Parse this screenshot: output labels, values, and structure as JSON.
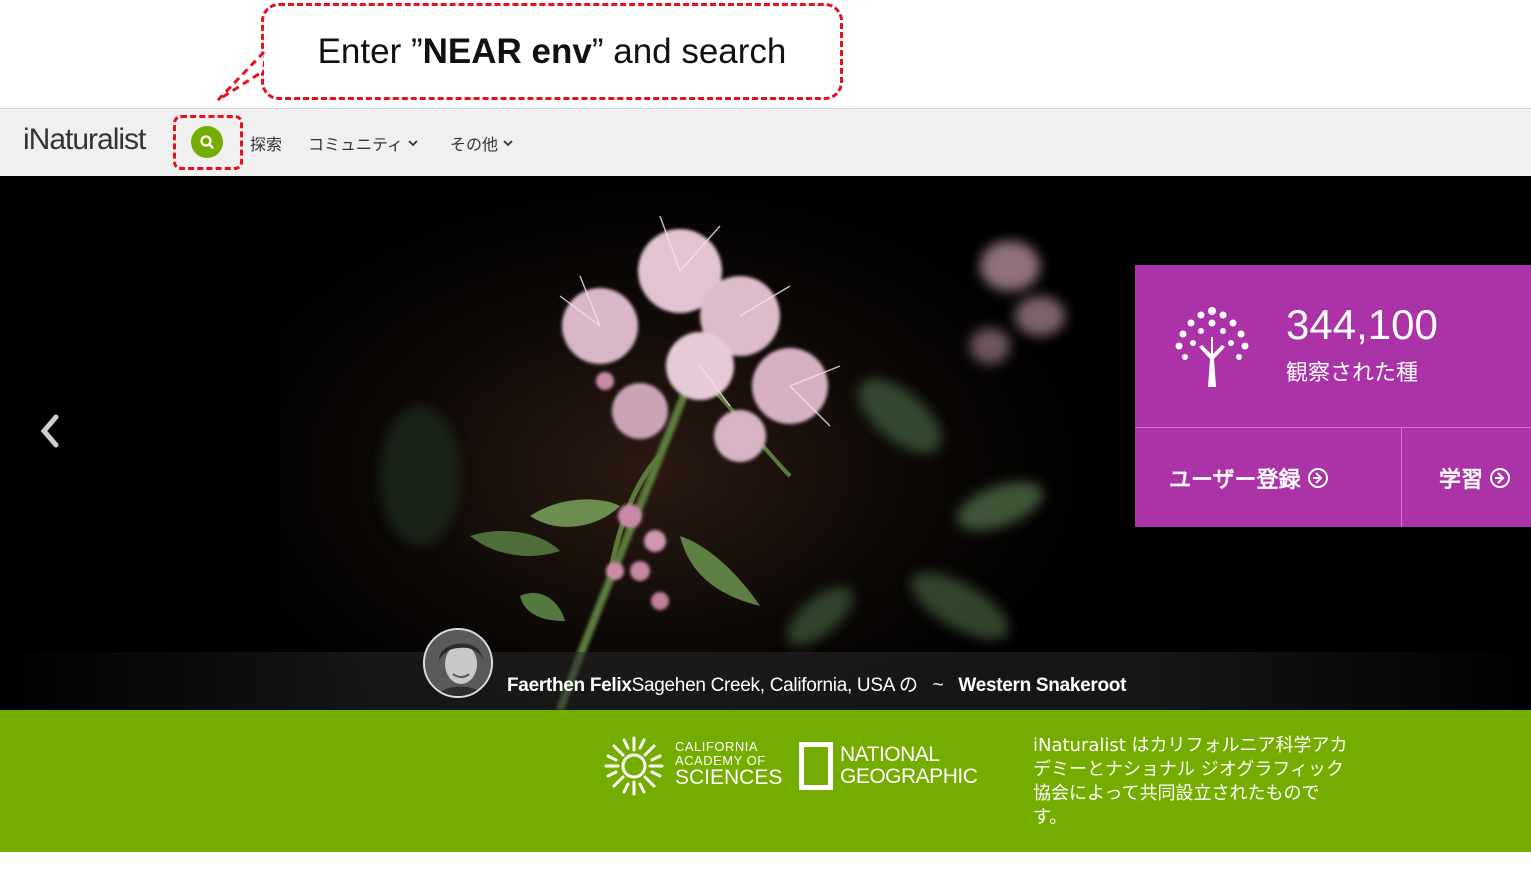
{
  "annotation": {
    "text_before": "Enter ”",
    "text_bold": "NEAR env",
    "text_after": "” and search"
  },
  "navbar": {
    "logo": "iNaturalist",
    "search_icon": "search-icon",
    "items": [
      {
        "label": "探索"
      },
      {
        "label": "コミュニティ"
      },
      {
        "label": "その他"
      }
    ]
  },
  "hero": {
    "stats": {
      "number": "344,100",
      "label": "観察された種"
    },
    "buttons": {
      "signup": "ユーザー登録",
      "learn": "学習"
    },
    "caption": {
      "observer": "Faerthen Felix",
      "place": "Sagehen Creek, California, USA の",
      "separator": "~",
      "species": "Western Snakeroot"
    }
  },
  "partners": {
    "cas": {
      "line1": "CALIFORNIA",
      "line2": "ACADEMY OF",
      "line3": "SCIENCES"
    },
    "natgeo": {
      "line1": "NATIONAL",
      "line2": "GEOGRAPHIC"
    },
    "description": "iNaturalist はカリフォルニア科学アカデミーとナショナル ジオグラフィック協会によって共同設立されたものです。"
  },
  "colors": {
    "green": "#74ac00",
    "magenta": "#ac32a8",
    "annotation_red": "#e8101e"
  }
}
